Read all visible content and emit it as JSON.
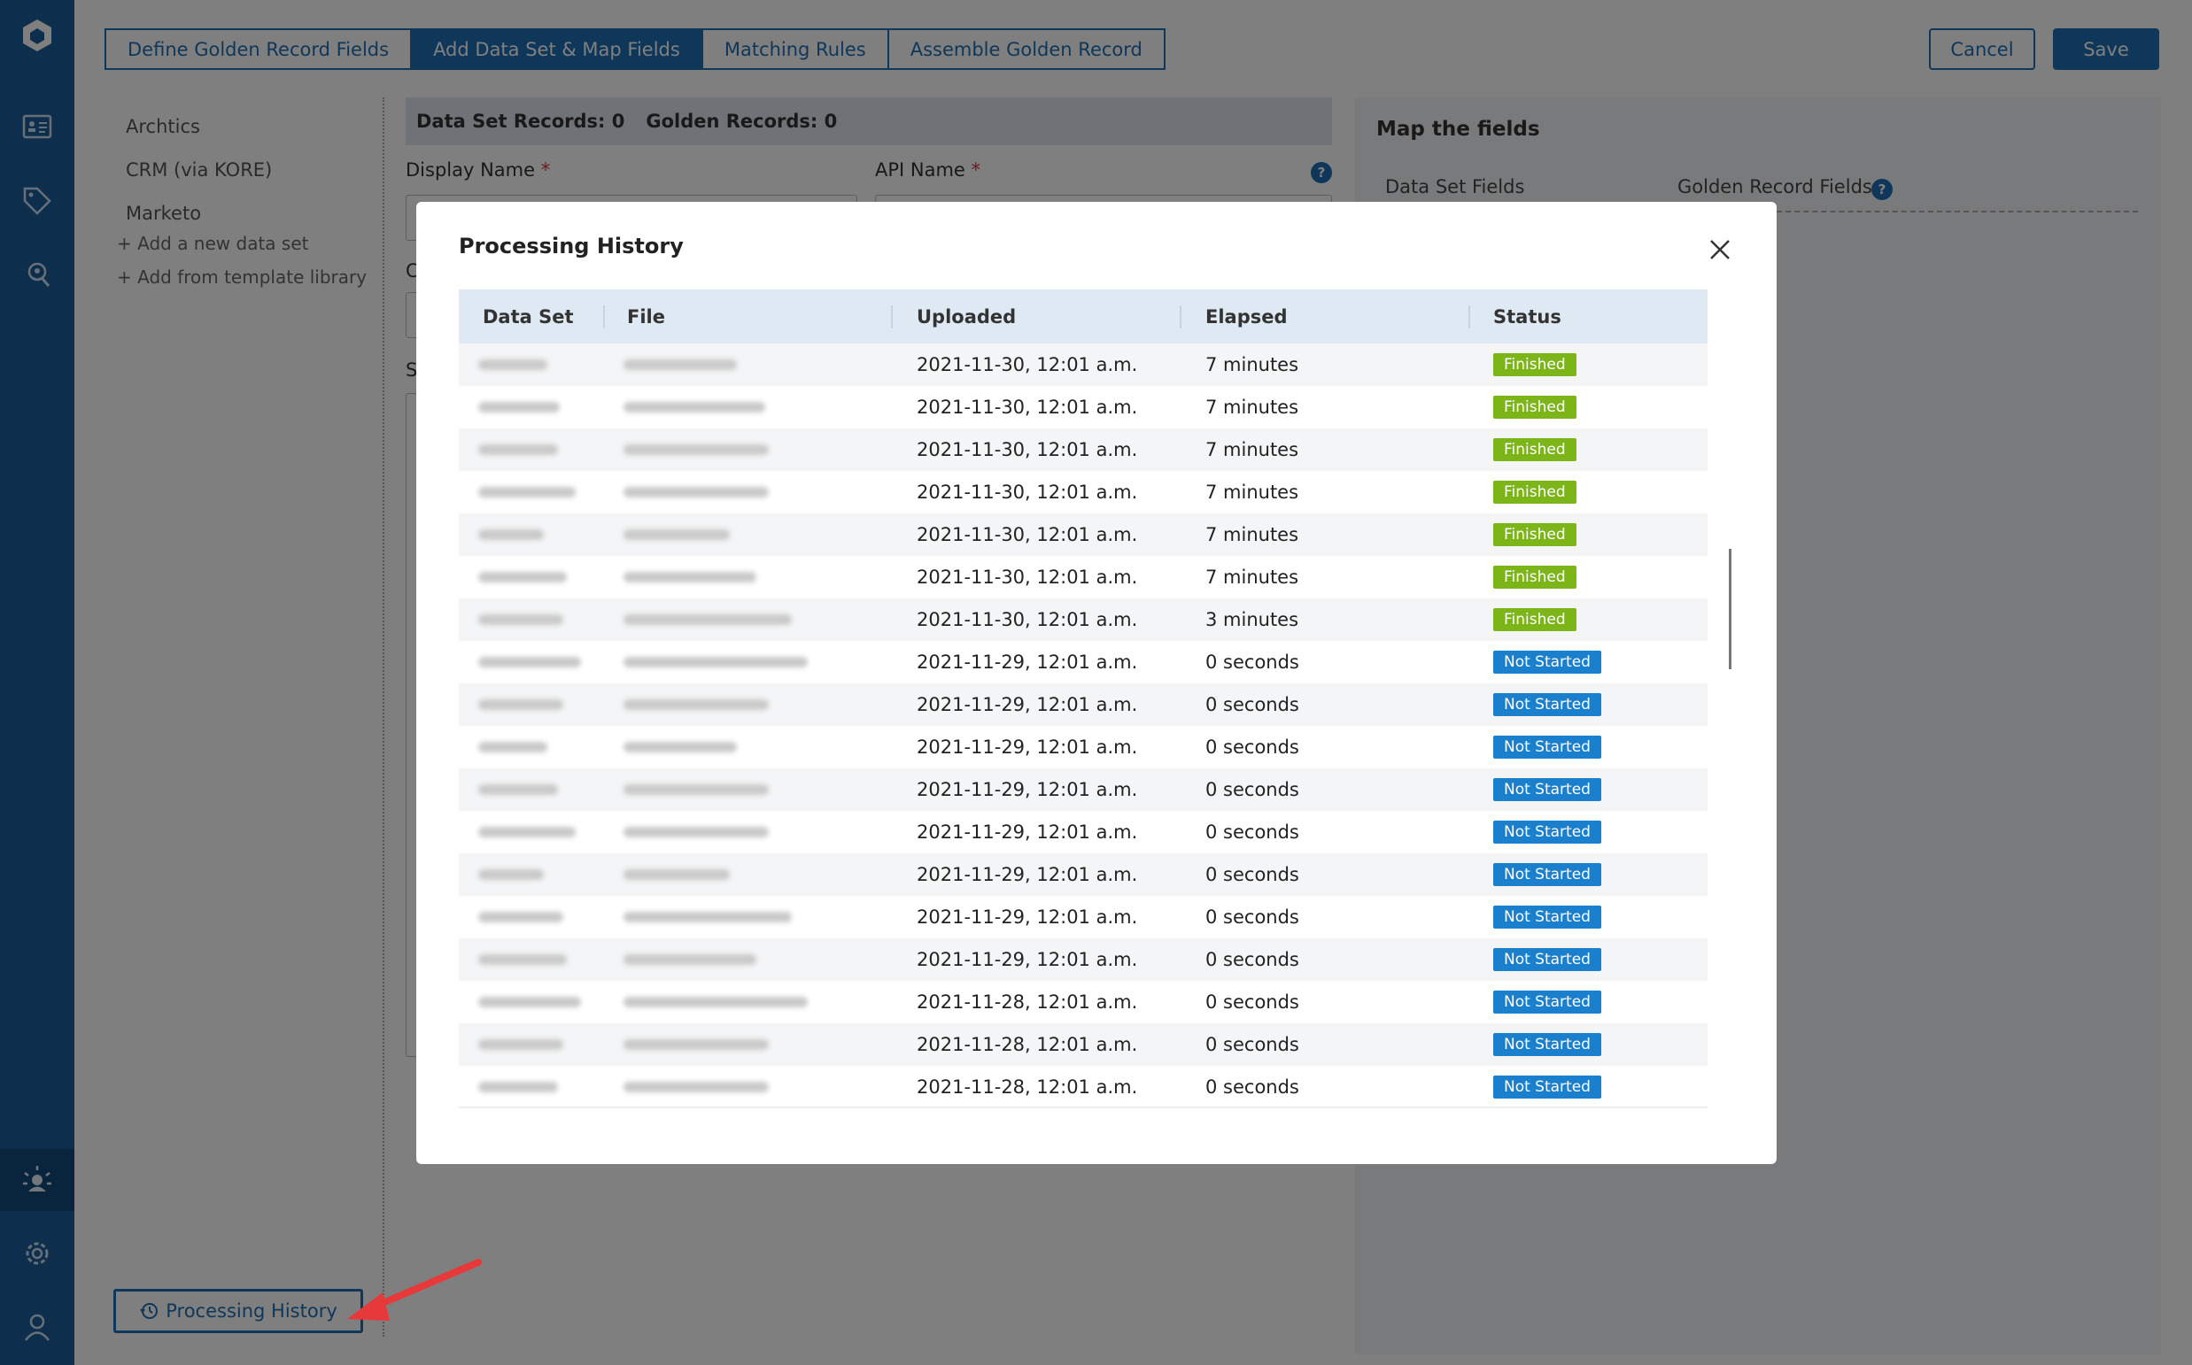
{
  "colors": {
    "primary": "#1f6fb2",
    "rail": "#1b5f9a",
    "finished": "#7cb518",
    "not_started": "#1a7fcc"
  },
  "nav": {
    "tabs": [
      {
        "label": "Define Golden Record Fields",
        "active": false
      },
      {
        "label": "Add Data Set & Map Fields",
        "active": true
      },
      {
        "label": "Matching Rules",
        "active": false
      },
      {
        "label": "Assemble Golden Record",
        "active": false
      }
    ],
    "cancel_label": "Cancel",
    "save_label": "Save"
  },
  "sidebar": {
    "datasets": [
      "Archtics",
      "CRM (via KORE)",
      "Marketo"
    ],
    "add_new": "+ Add a new data set",
    "add_template": "+ Add from template library"
  },
  "form": {
    "dataset_records": "Data Set Records: 0",
    "golden_records": "Golden Records: 0",
    "display_name_label": "Display Name",
    "api_name_label": "API Name",
    "required_mark": "*",
    "help": "?",
    "partial_label_c": "C",
    "partial_label_s": "S"
  },
  "map": {
    "title": "Map the fields",
    "col_dataset": "Data Set Fields",
    "col_golden": "Golden Record Fields"
  },
  "processing_button": {
    "label": "Processing History",
    "icon": "history-icon"
  },
  "modal": {
    "title": "Processing History",
    "columns": [
      "Data Set",
      "File",
      "Uploaded",
      "Elapsed",
      "Status"
    ],
    "rows": [
      {
        "uploaded": "2021-11-30, 12:01 a.m.",
        "elapsed": "7 minutes",
        "status": "Finished"
      },
      {
        "uploaded": "2021-11-30, 12:01 a.m.",
        "elapsed": "7 minutes",
        "status": "Finished"
      },
      {
        "uploaded": "2021-11-30, 12:01 a.m.",
        "elapsed": "7 minutes",
        "status": "Finished"
      },
      {
        "uploaded": "2021-11-30, 12:01 a.m.",
        "elapsed": "7 minutes",
        "status": "Finished"
      },
      {
        "uploaded": "2021-11-30, 12:01 a.m.",
        "elapsed": "7 minutes",
        "status": "Finished"
      },
      {
        "uploaded": "2021-11-30, 12:01 a.m.",
        "elapsed": "7 minutes",
        "status": "Finished"
      },
      {
        "uploaded": "2021-11-30, 12:01 a.m.",
        "elapsed": "3 minutes",
        "status": "Finished"
      },
      {
        "uploaded": "2021-11-29, 12:01 a.m.",
        "elapsed": "0 seconds",
        "status": "Not Started"
      },
      {
        "uploaded": "2021-11-29, 12:01 a.m.",
        "elapsed": "0 seconds",
        "status": "Not Started"
      },
      {
        "uploaded": "2021-11-29, 12:01 a.m.",
        "elapsed": "0 seconds",
        "status": "Not Started"
      },
      {
        "uploaded": "2021-11-29, 12:01 a.m.",
        "elapsed": "0 seconds",
        "status": "Not Started"
      },
      {
        "uploaded": "2021-11-29, 12:01 a.m.",
        "elapsed": "0 seconds",
        "status": "Not Started"
      },
      {
        "uploaded": "2021-11-29, 12:01 a.m.",
        "elapsed": "0 seconds",
        "status": "Not Started"
      },
      {
        "uploaded": "2021-11-29, 12:01 a.m.",
        "elapsed": "0 seconds",
        "status": "Not Started"
      },
      {
        "uploaded": "2021-11-29, 12:01 a.m.",
        "elapsed": "0 seconds",
        "status": "Not Started"
      },
      {
        "uploaded": "2021-11-28, 12:01 a.m.",
        "elapsed": "0 seconds",
        "status": "Not Started"
      },
      {
        "uploaded": "2021-11-28, 12:01 a.m.",
        "elapsed": "0 seconds",
        "status": "Not Started"
      },
      {
        "uploaded": "2021-11-28, 12:01 a.m.",
        "elapsed": "0 seconds",
        "status": "Not Started"
      }
    ]
  }
}
